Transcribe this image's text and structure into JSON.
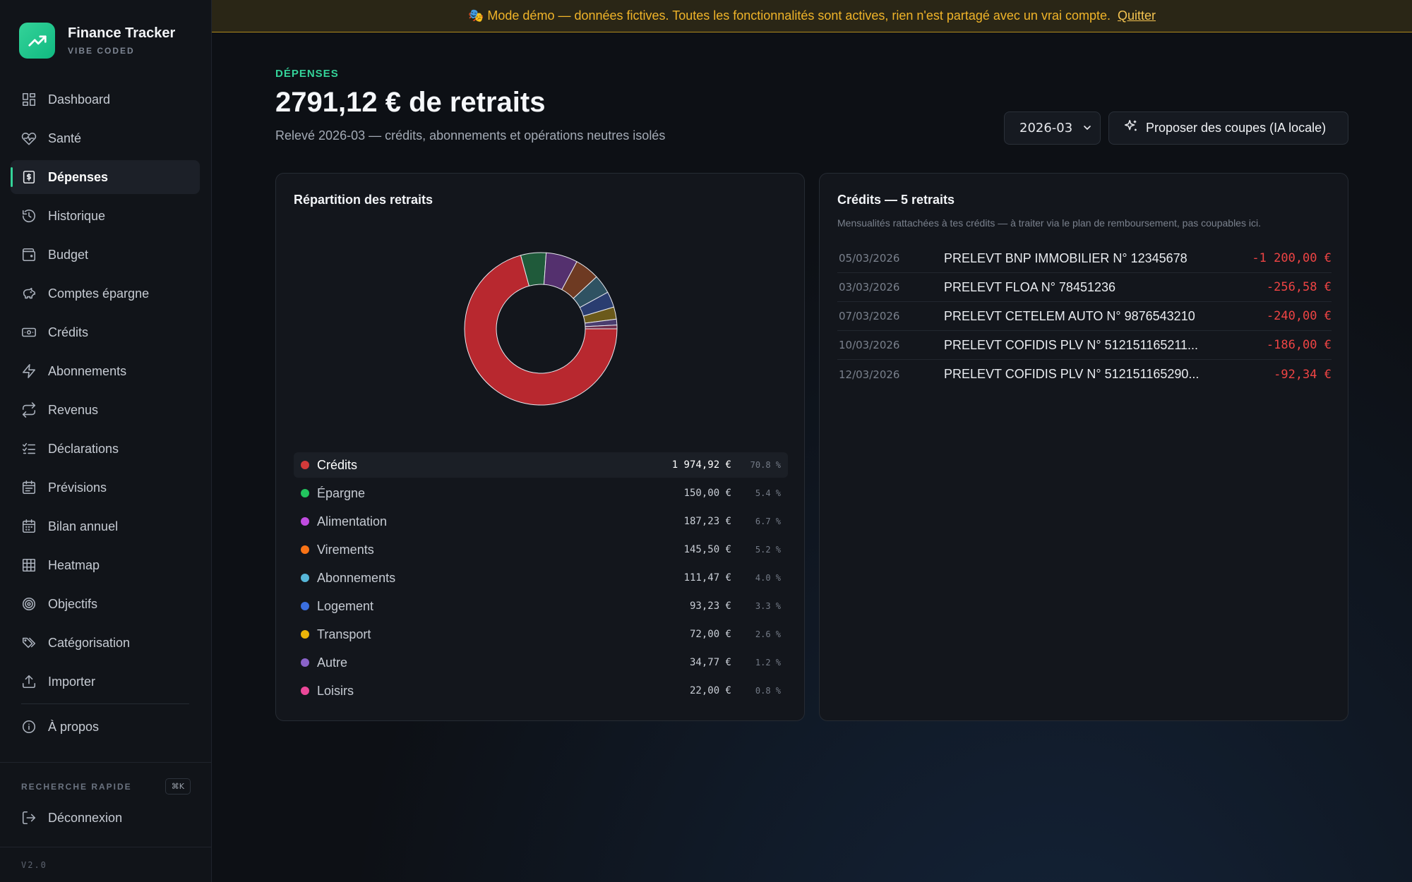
{
  "brand": {
    "title": "Finance Tracker",
    "subtitle": "VIBE CODED"
  },
  "banner": {
    "text": "🎭 Mode démo — données fictives. Toutes les fonctionnalités sont actives, rien n'est partagé avec un vrai compte.",
    "quit": "Quitter"
  },
  "nav": {
    "items": [
      {
        "label": "Dashboard",
        "icon": "dashboard-icon"
      },
      {
        "label": "Santé",
        "icon": "heart-pulse-icon"
      },
      {
        "label": "Dépenses",
        "icon": "receipt-dollar-icon",
        "active": true
      },
      {
        "label": "Historique",
        "icon": "history-icon"
      },
      {
        "label": "Budget",
        "icon": "wallet-icon"
      },
      {
        "label": "Comptes épargne",
        "icon": "piggy-bank-icon"
      },
      {
        "label": "Crédits",
        "icon": "banknote-icon"
      },
      {
        "label": "Abonnements",
        "icon": "bolt-icon"
      },
      {
        "label": "Revenus",
        "icon": "repeat-icon"
      },
      {
        "label": "Déclarations",
        "icon": "checklist-icon"
      },
      {
        "label": "Prévisions",
        "icon": "calendar-forecast-icon"
      },
      {
        "label": "Bilan annuel",
        "icon": "calendar-icon"
      },
      {
        "label": "Heatmap",
        "icon": "grid-icon"
      },
      {
        "label": "Objectifs",
        "icon": "target-icon"
      },
      {
        "label": "Catégorisation",
        "icon": "tags-icon"
      },
      {
        "label": "Importer",
        "icon": "upload-icon"
      }
    ],
    "about": "À propos",
    "quick_search": "RECHERCHE RAPIDE",
    "shortcut": "⌘K",
    "logout": "Déconnexion",
    "version": "V2.0"
  },
  "header": {
    "eyebrow": "DÉPENSES",
    "title": "2791,12 € de retraits",
    "subtitle": "Relevé 2026-03 — crédits, abonnements et opérations neutres isolés",
    "month": "2026-03",
    "ai_button": "Proposer des coupes (IA locale)"
  },
  "breakdown": {
    "title": "Répartition des retraits"
  },
  "chart_data": {
    "type": "pie",
    "categories": [
      "Crédits",
      "Épargne",
      "Alimentation",
      "Virements",
      "Abonnements",
      "Logement",
      "Transport",
      "Autre",
      "Loisirs"
    ],
    "values": [
      1974.92,
      150.0,
      187.23,
      145.5,
      111.47,
      93.23,
      72.0,
      34.77,
      22.0
    ],
    "amounts": [
      "1 974,92 €",
      "150,00 €",
      "187,23 €",
      "145,50 €",
      "111,47 €",
      "93,23 €",
      "72,00 €",
      "34,77 €",
      "22,00 €"
    ],
    "percents": [
      "70.8 %",
      "5.4 %",
      "6.7 %",
      "5.2 %",
      "4.0 %",
      "3.3 %",
      "2.6 %",
      "1.2 %",
      "0.8 %"
    ],
    "legend_colors": [
      "#d23a3a",
      "#22c55e",
      "#c04ce0",
      "#f97316",
      "#56b6d8",
      "#3b6fe0",
      "#eab308",
      "#8a63c9",
      "#ec4899"
    ],
    "slice_colors": [
      "#b8282f",
      "#1f5a3a",
      "#54306e",
      "#6e3a22",
      "#2f5262",
      "#2a3d70",
      "#6b5a1b",
      "#4a3d6e",
      "#6e2d4b"
    ],
    "slice_order": [
      0,
      1,
      2,
      3,
      4,
      5,
      6,
      7,
      8
    ],
    "donut": true
  },
  "credits": {
    "title": "Crédits — 5 retraits",
    "desc": "Mensualités rattachées à tes crédits — à traiter via le plan de remboursement, pas coupables ici.",
    "rows": [
      {
        "date": "05/03/2026",
        "label": "PRELEVT BNP IMMOBILIER N° 12345678",
        "amount": "-1 200,00 €"
      },
      {
        "date": "03/03/2026",
        "label": "PRELEVT FLOA N° 78451236",
        "amount": "-256,58 €"
      },
      {
        "date": "07/03/2026",
        "label": "PRELEVT CETELEM AUTO N° 9876543210",
        "amount": "-240,00 €"
      },
      {
        "date": "10/03/2026",
        "label": "PRELEVT COFIDIS PLV N° 512151165211...",
        "amount": "-186,00 €"
      },
      {
        "date": "12/03/2026",
        "label": "PRELEVT COFIDIS PLV N° 512151165290...",
        "amount": "-92,34 €"
      }
    ]
  },
  "colors": {
    "accent": "#34d399",
    "danger": "#ef4444",
    "banner": "#f0b429"
  }
}
